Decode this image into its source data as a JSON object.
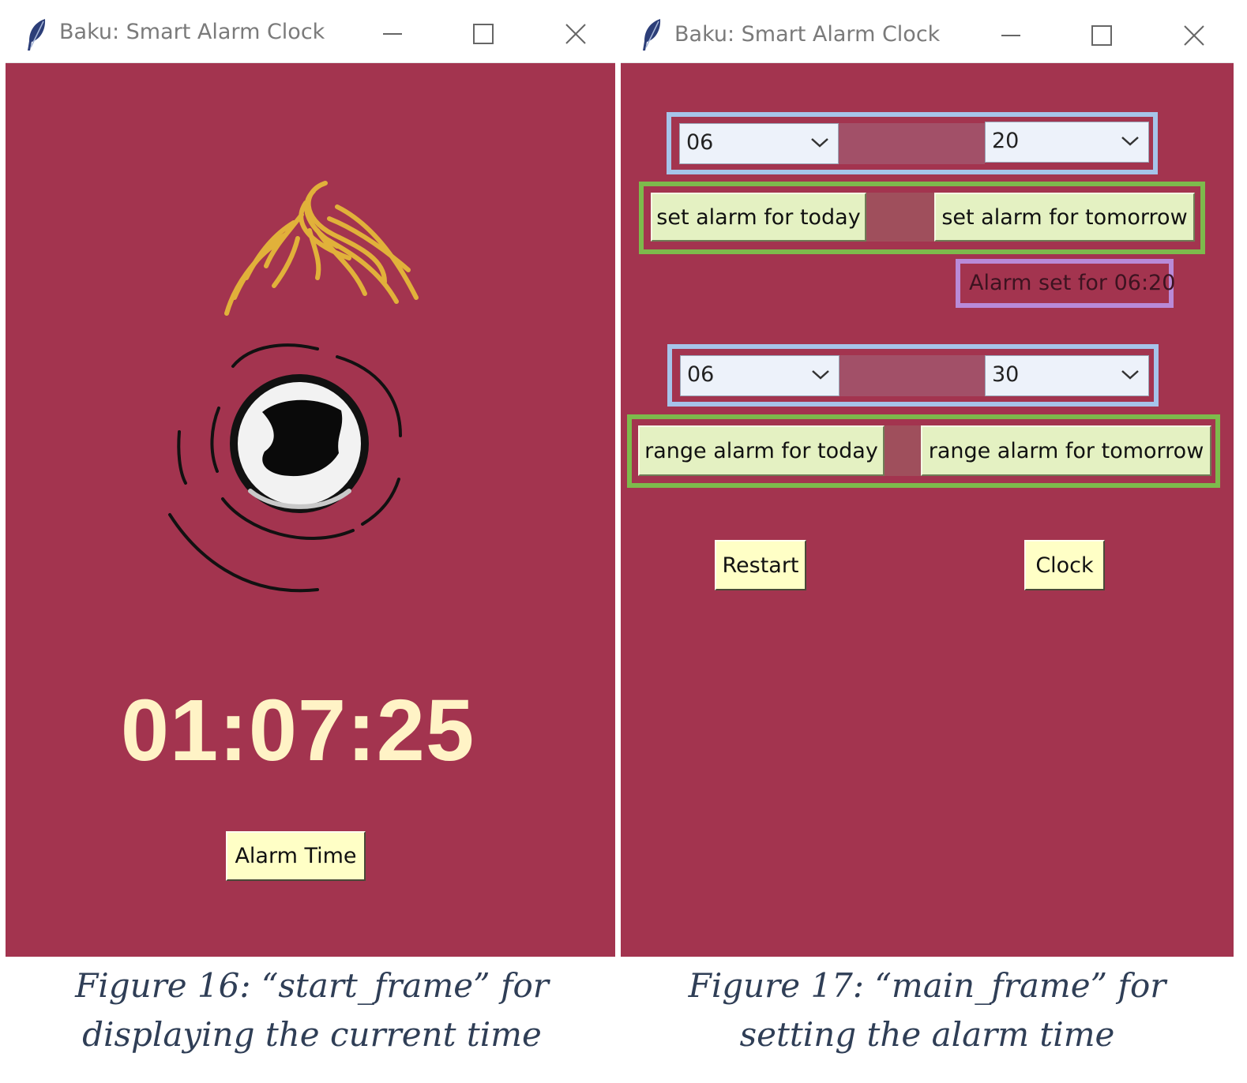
{
  "start_frame": {
    "window_title": "Baku: Smart Alarm Clock",
    "icons": [
      "feather-icon",
      "minimize-icon",
      "maximize-icon",
      "close-icon"
    ],
    "mascot": "eye-mascot-illustration",
    "time": "01:07:25",
    "alarm_button": "Alarm Time",
    "caption_line1": "Figure 16: “start_frame” for",
    "caption_line2": "displaying the current time"
  },
  "main_frame": {
    "window_title": "Baku: Smart Alarm Clock",
    "set_hour": "06",
    "set_minute": "20",
    "set_today_button": "set alarm for today",
    "set_tomorrow_button": "set alarm for tomorrow",
    "alarm_status": "Alarm set for 06:20",
    "range_hour": "06",
    "range_minute": "30",
    "range_today_button": "range alarm for today",
    "range_tomorrow_button": "range alarm for tomorrow",
    "restart_button": "Restart",
    "clock_button": "Clock",
    "caption_line1": "Figure 17: “main_frame” for",
    "caption_line2": "setting the alarm time"
  },
  "colors": {
    "window_background": "#a3344f",
    "time_text": "#fff3c6",
    "button_yellow": "#ffffc6",
    "button_green": "#e4f1c2",
    "highlight_blue": "#a6c4ea",
    "highlight_green": "#7dba4c",
    "highlight_purple": "#b98ad8",
    "caption_text": "#2f3e56"
  }
}
